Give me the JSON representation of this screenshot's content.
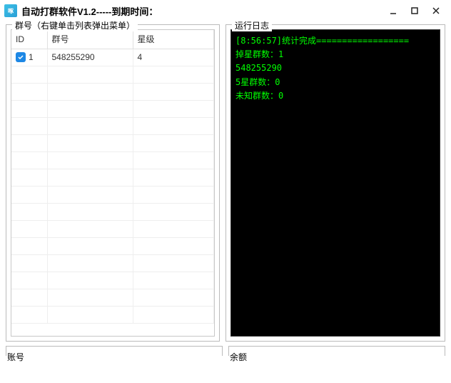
{
  "window": {
    "title": "自动打群软件V1.2-----到期时间："
  },
  "left": {
    "legend": "群号（右键单击列表弹出菜单）",
    "columns": {
      "id": "ID",
      "group": "群号",
      "star": "星级"
    },
    "rows": [
      {
        "checked": true,
        "id": "1",
        "group": "548255290",
        "star": "4"
      }
    ]
  },
  "right": {
    "legend": "运行日志",
    "log": [
      "[8:56:57]统计完成==================",
      "掉星群数：1",
      "548255290",
      "",
      "5星群数：0",
      "",
      "未知群数：0"
    ]
  },
  "footer": {
    "account_label": "账号",
    "balance_label": "余额"
  }
}
